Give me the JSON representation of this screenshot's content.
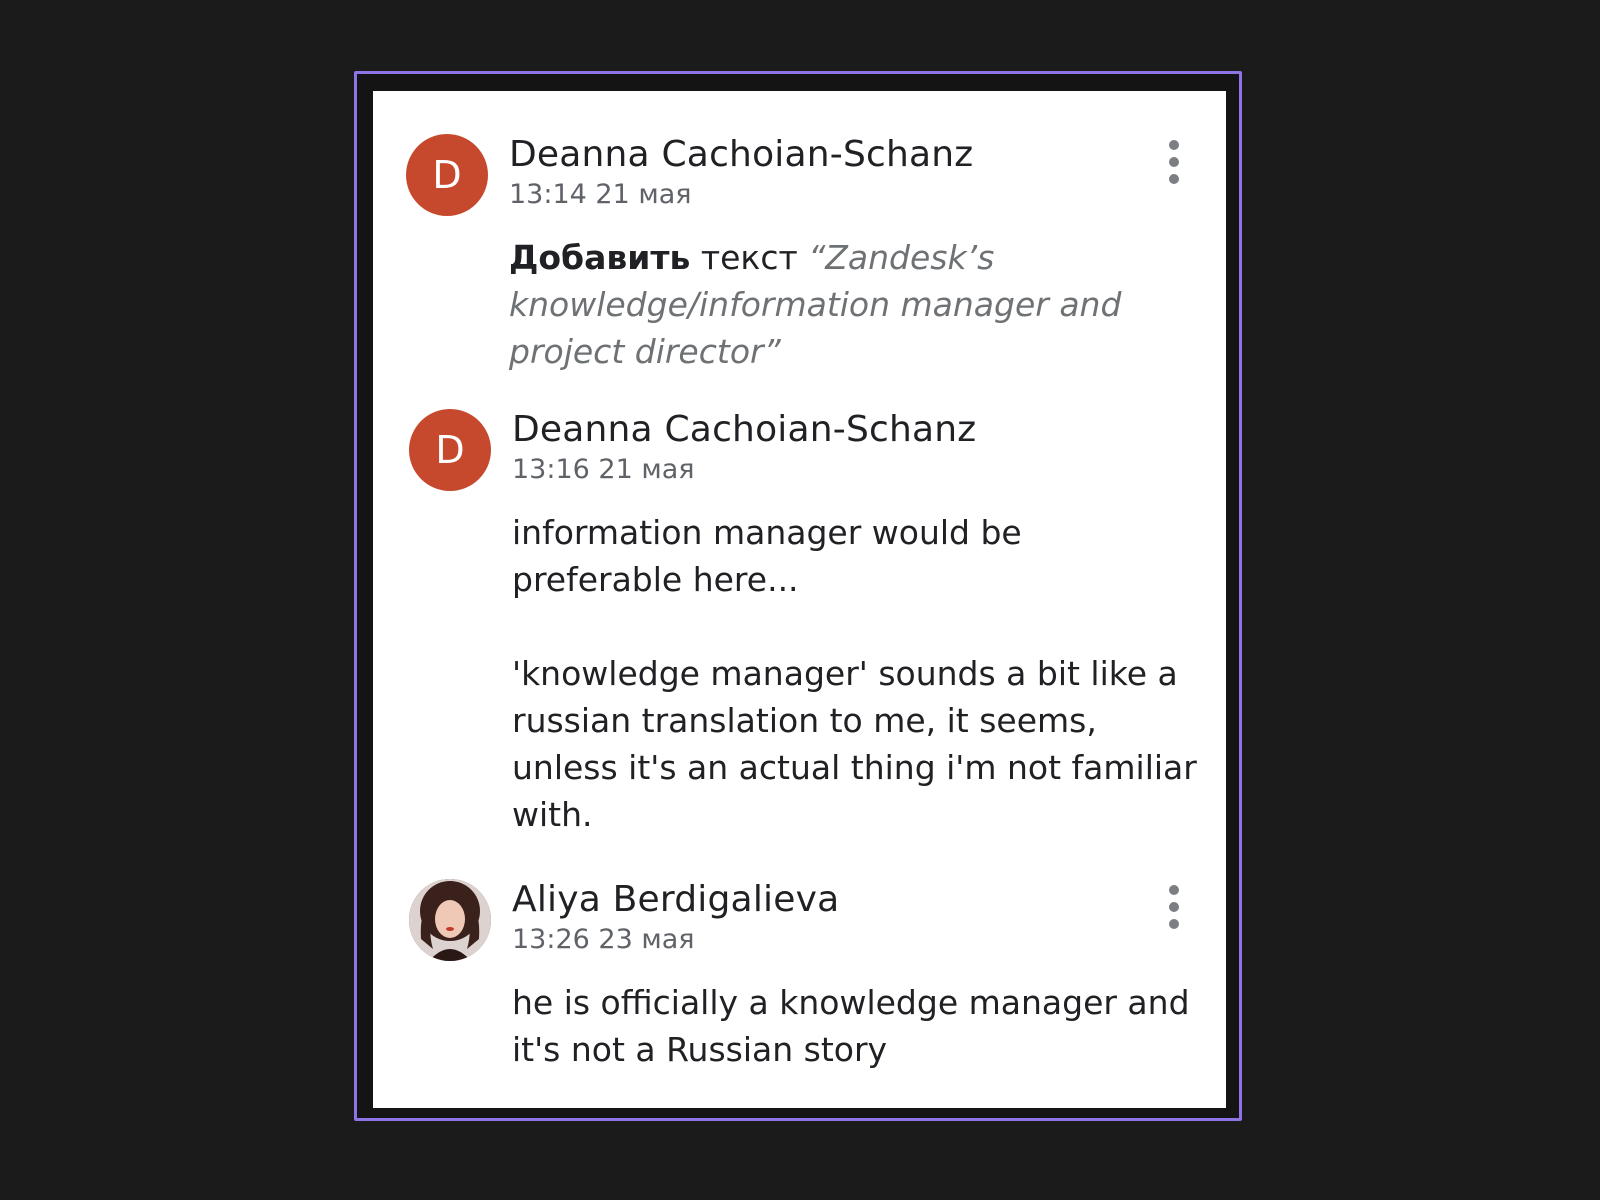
{
  "comments": [
    {
      "avatar_letter": "D",
      "author": "Deanna Cachoian-Schanz",
      "time": "13:14 21 мая",
      "action_verb": "Добавить",
      "action_noun": "текст",
      "quoted_text": "“Zandesk’s knowledge/information manager and project director”",
      "has_menu": true
    },
    {
      "avatar_letter": "D",
      "author": "Deanna Cachoian-Schanz",
      "time": "13:16 21 мая",
      "paragraphs": [
        "information manager would be preferable here...",
        "'knowledge manager' sounds a bit like a russian translation to me, it seems, unless it's an actual thing i'm not familiar with."
      ],
      "has_menu": false
    },
    {
      "avatar_letter": "",
      "avatar_type": "photo",
      "author": "Aliya Berdigalieva",
      "time": "13:26 23 мая",
      "paragraphs": [
        "he is officially a knowledge manager and it's not a Russian story"
      ],
      "has_menu": true
    }
  ],
  "colors": {
    "avatar_bg": "#c6492e",
    "frame_border": "#8f74e6",
    "page_bg": "#1b1b1b"
  },
  "icons": {
    "menu": "more-vert-icon"
  }
}
